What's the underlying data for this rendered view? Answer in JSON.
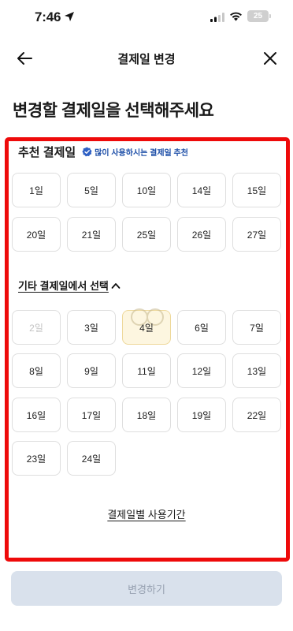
{
  "status_bar": {
    "time": "7:46",
    "battery": "25"
  },
  "nav": {
    "title": "결제일 변경"
  },
  "page_title": "변경할 결제일을 선택해주세요",
  "recommended": {
    "title": "추천 결제일",
    "badge": "많이 사용하시는 결제일 추천",
    "days": [
      "1일",
      "5일",
      "10일",
      "14일",
      "15일",
      "20일",
      "21일",
      "25일",
      "26일",
      "27일"
    ]
  },
  "other": {
    "label": "기타 결제일에서 선택",
    "days": [
      "2일",
      "3일",
      "4일",
      "6일",
      "7일",
      "8일",
      "9일",
      "11일",
      "12일",
      "13일",
      "16일",
      "17일",
      "18일",
      "19일",
      "22일",
      "23일",
      "24일"
    ],
    "disabled": [
      "2일"
    ],
    "selected": "4일"
  },
  "usage_link": "결제일별 사용기간",
  "submit_button": "변경하기",
  "colors": {
    "highlight": "#ee0a0a",
    "badge_blue": "#1e4fa8",
    "submit_bg": "#d9e1ec"
  }
}
